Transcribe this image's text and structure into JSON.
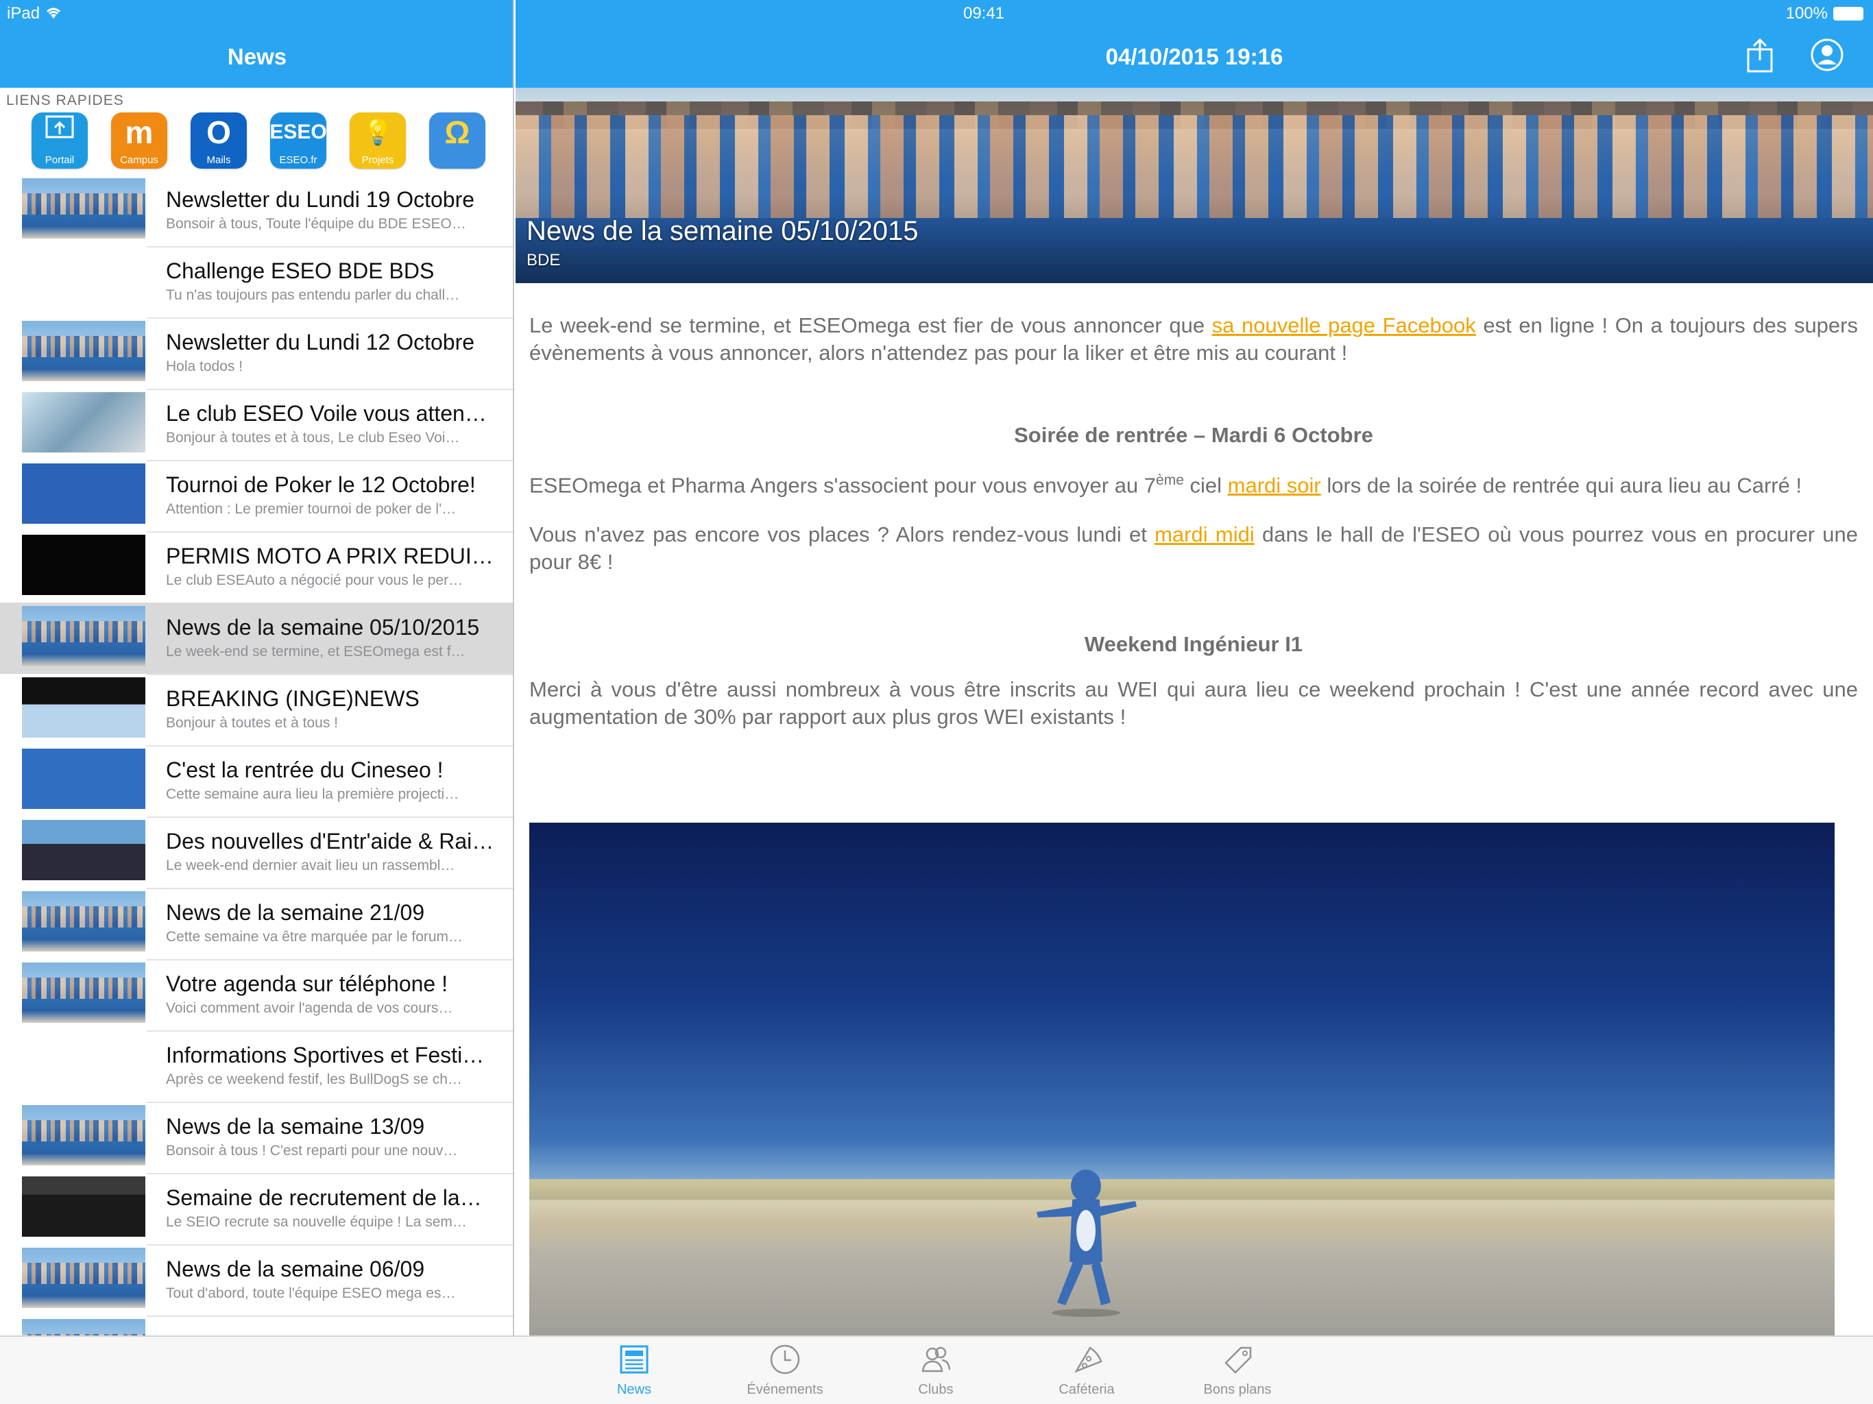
{
  "status_bar": {
    "device": "iPad",
    "time": "09:41",
    "battery": "100%"
  },
  "master": {
    "nav_title": "News",
    "quick_links_label": "LIENS RAPIDES",
    "quick_links": [
      {
        "label": "Portail",
        "glyph": "⬒",
        "color": "#1e9be0"
      },
      {
        "label": "Campus",
        "glyph": "m",
        "color": "#f08a12"
      },
      {
        "label": "Mails",
        "glyph": "O",
        "color": "#0f64c4"
      },
      {
        "label": "ESEO.fr",
        "glyph": "ESEO",
        "color": "#1a8fe0"
      },
      {
        "label": "Projets",
        "glyph": "💡",
        "color": "#f4c213"
      },
      {
        "label": "",
        "glyph": "Ω",
        "color": "#3a8fe0"
      }
    ],
    "news": [
      {
        "title": "Newsletter du Lundi 19 Octobre",
        "subtitle": "Bonsoir à tous, Toute l'équipe du BDE ESEO…",
        "thumb": "crowd"
      },
      {
        "title": "Challenge ESEO BDE BDS",
        "subtitle": "Tu n'as toujours pas entendu parler du chall…",
        "thumb": "bulldog"
      },
      {
        "title": "Newsletter du Lundi 12 Octobre",
        "subtitle": "Hola todos !",
        "thumb": "crowd"
      },
      {
        "title": "Le club ESEO Voile vous attend…",
        "subtitle": "Bonjour à toutes et à tous, Le club Eseo Voi…",
        "thumb": "voile"
      },
      {
        "title": "Tournoi de Poker le 12 Octobre!",
        "subtitle": "Attention : Le premier tournoi de poker de l'…",
        "thumb": "poker"
      },
      {
        "title": "PERMIS MOTO A PRIX REDUIT !",
        "subtitle": "Le club ESEAuto a négocié pour vous le per…",
        "thumb": "auto"
      },
      {
        "title": "News de la semaine 05/10/2015",
        "subtitle": "Le week-end se termine, et ESEOmega est f…",
        "thumb": "crowd",
        "selected": true
      },
      {
        "title": "BREAKING (INGE)NEWS",
        "subtitle": "Bonjour à toutes et à tous !",
        "thumb": "inge"
      },
      {
        "title": "C'est la rentrée du Cineseo !",
        "subtitle": "Cette semaine aura lieu la première projecti…",
        "thumb": "cineseo"
      },
      {
        "title": "Des nouvelles d'Entr'aide & Rai…",
        "subtitle": "Le week-end dernier avait lieu un rassembl…",
        "thumb": "entraide"
      },
      {
        "title": "News de la semaine 21/09",
        "subtitle": "Cette semaine va être marquée par le forum…",
        "thumb": "crowd"
      },
      {
        "title": "Votre agenda sur téléphone !",
        "subtitle": "Voici comment avoir l'agenda de vos cours…",
        "thumb": "crowd"
      },
      {
        "title": "Informations Sportives et Festi…",
        "subtitle": "Après ce weekend festif, les BullDogS se ch…",
        "thumb": "bulldog"
      },
      {
        "title": "News de la semaine 13/09",
        "subtitle": "Bonsoir à tous ! C'est reparti pour une nouv…",
        "thumb": "crowd"
      },
      {
        "title": "Semaine de recrutement de la…",
        "subtitle": "Le SEIO recrute sa nouvelle équipe ! La sem…",
        "thumb": "suits"
      },
      {
        "title": "News de la semaine 06/09",
        "subtitle": "Tout d'abord, toute l'équipe ESEO mega es…",
        "thumb": "crowd"
      },
      {
        "title": "",
        "subtitle": "",
        "thumb": "crowd"
      }
    ]
  },
  "detail": {
    "nav_title": "04/10/2015 19:16",
    "share_icon": "share-icon",
    "profile_icon": "user-icon",
    "hero_title": "News de la semaine 05/10/2015",
    "hero_tag": "BDE",
    "p1_before": "Le week-end se termine, et ESEOmega est fier de vous annoncer que ",
    "p1_link": "sa nouvelle page Facebook",
    "p1_after": " est en ligne ! On a toujours des supers évènements à vous annoncer, alors n'attendez pas pour la liker et être mis au courant !",
    "h1": "Soirée de rentrée – Mardi 6 Octobre",
    "p2_before": "ESEOmega et Pharma Angers s'associent pour vous envoyer au 7",
    "p2_sup": "ème",
    "p2_mid": " ciel ",
    "p2_link": "mardi soir",
    "p2_after": " lors de la soirée de rentrée qui aura lieu au Carré !",
    "p3_before": "Vous n'avez pas encore vos places ? Alors rendez-vous lundi et ",
    "p3_link": "mardi midi",
    "p3_after": " dans le hall de l'ESEO où vous pourrez vous en procurer une pour 8€ !",
    "h2": "Weekend Ingénieur I1",
    "p4": "Merci à vous d'être aussi nombreux à vous être inscrits au WEI qui aura lieu ce weekend prochain ! C'est une année record avec une augmentation de 30% par rapport aux plus gros WEI existants !"
  },
  "tabs": [
    {
      "label": "News",
      "icon": "newspaper-icon",
      "active": true
    },
    {
      "label": "Événements",
      "icon": "clock-icon"
    },
    {
      "label": "Clubs",
      "icon": "people-icon"
    },
    {
      "label": "Caféteria",
      "icon": "pizza-icon"
    },
    {
      "label": "Bons plans",
      "icon": "tag-icon"
    }
  ],
  "colors": {
    "accent": "#2aa5f2",
    "link": "#f0a500",
    "selected_row": "#d9d9d9"
  }
}
